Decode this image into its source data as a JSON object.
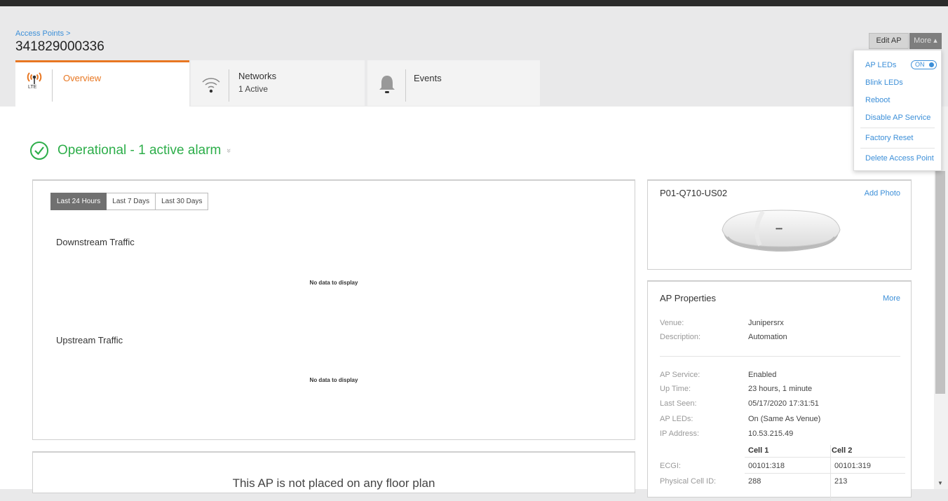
{
  "header": {
    "breadcrumb": "Access Points >",
    "title": "341829000336",
    "edit_label": "Edit AP",
    "more_label": "More ▴"
  },
  "tabs": [
    {
      "label": "Overview",
      "icon_sub": "LTE"
    },
    {
      "label": "Networks",
      "sub": "1 Active"
    },
    {
      "label": "Events"
    }
  ],
  "status": {
    "text": "Operational - 1 active alarm",
    "chevron": "»"
  },
  "traffic": {
    "ranges": [
      "Last 24 Hours",
      "Last 7 Days",
      "Last 30 Days"
    ],
    "selected_range": "Last 24 Hours",
    "downstream_title": "Downstream Traffic",
    "upstream_title": "Upstream Traffic",
    "no_data": "No data to display"
  },
  "floorplan": {
    "text": "This AP is not placed on any floor plan"
  },
  "device": {
    "model": "P01-Q710-US02",
    "add_photo": "Add Photo",
    "led_dots": "•••••"
  },
  "properties": {
    "title": "AP Properties",
    "more": "More",
    "venue_label": "Venue:",
    "venue_value": "Junipersrx",
    "description_label": "Description:",
    "description_value": "Automation",
    "service_label": "AP Service:",
    "service_value": "Enabled",
    "uptime_label": "Up Time:",
    "uptime_value": "23 hours, 1 minute",
    "lastseen_label": "Last Seen:",
    "lastseen_value": "05/17/2020 17:31:51",
    "leds_label": "AP LEDs:",
    "leds_value": "On (Same As Venue)",
    "ip_label": "IP Address:",
    "ip_value": "10.53.215.49",
    "cell1_head": "Cell 1",
    "cell2_head": "Cell 2",
    "ecgi_label": "ECGI:",
    "ecgi_cell1": "00101:318",
    "ecgi_cell2": "00101:319",
    "pci_label": "Physical Cell ID:",
    "pci_cell1": "288",
    "pci_cell2": "213"
  },
  "more_menu": {
    "ap_leds": "AP LEDs",
    "toggle": "ON",
    "blink": "Blink LEDs",
    "reboot": "Reboot",
    "disable": "Disable AP Service",
    "factory_reset": "Factory Reset",
    "delete": "Delete Access Point"
  },
  "colors": {
    "accent_orange": "#e87722",
    "link_blue": "#3c8fd8",
    "status_green": "#2dae4a"
  }
}
